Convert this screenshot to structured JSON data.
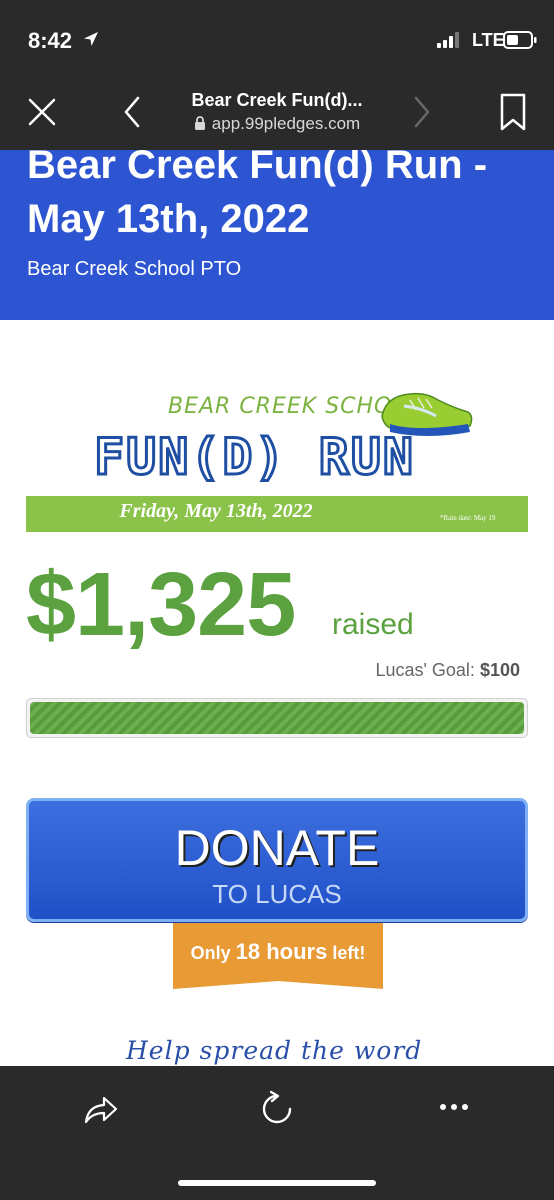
{
  "status_bar": {
    "time": "8:42",
    "network": "LTE"
  },
  "browser": {
    "title": "Bear Creek Fun(d)...",
    "url": "app.99pledges.com"
  },
  "hero": {
    "title": "Bear Creek Fun(d) Run - May 13th, 2022",
    "organization": "Bear Creek School PTO",
    "background_color": "#2d55d1"
  },
  "logo": {
    "school": "BEAR CREEK SCHOOL",
    "event": "FUN(D) RUN",
    "date": "Friday, May 13th, 2022",
    "rain_date": "*Rain date: May 19"
  },
  "fundraising": {
    "amount": "$1,325",
    "raised_label": "raised",
    "goal_label": "Lucas' Goal:",
    "goal_value": "$100",
    "progress_fraction": 1.0,
    "accent_color": "#5ba13f"
  },
  "donate": {
    "label": "DONATE",
    "sub_label": "TO LUCAS"
  },
  "countdown": {
    "prefix": "Only",
    "highlight": "18 hours",
    "suffix": "left!",
    "color": "#e89a35"
  },
  "help_text": "Help spread the word",
  "toolbar": {
    "icons": [
      "share-icon",
      "reload-icon",
      "more-icon"
    ]
  }
}
